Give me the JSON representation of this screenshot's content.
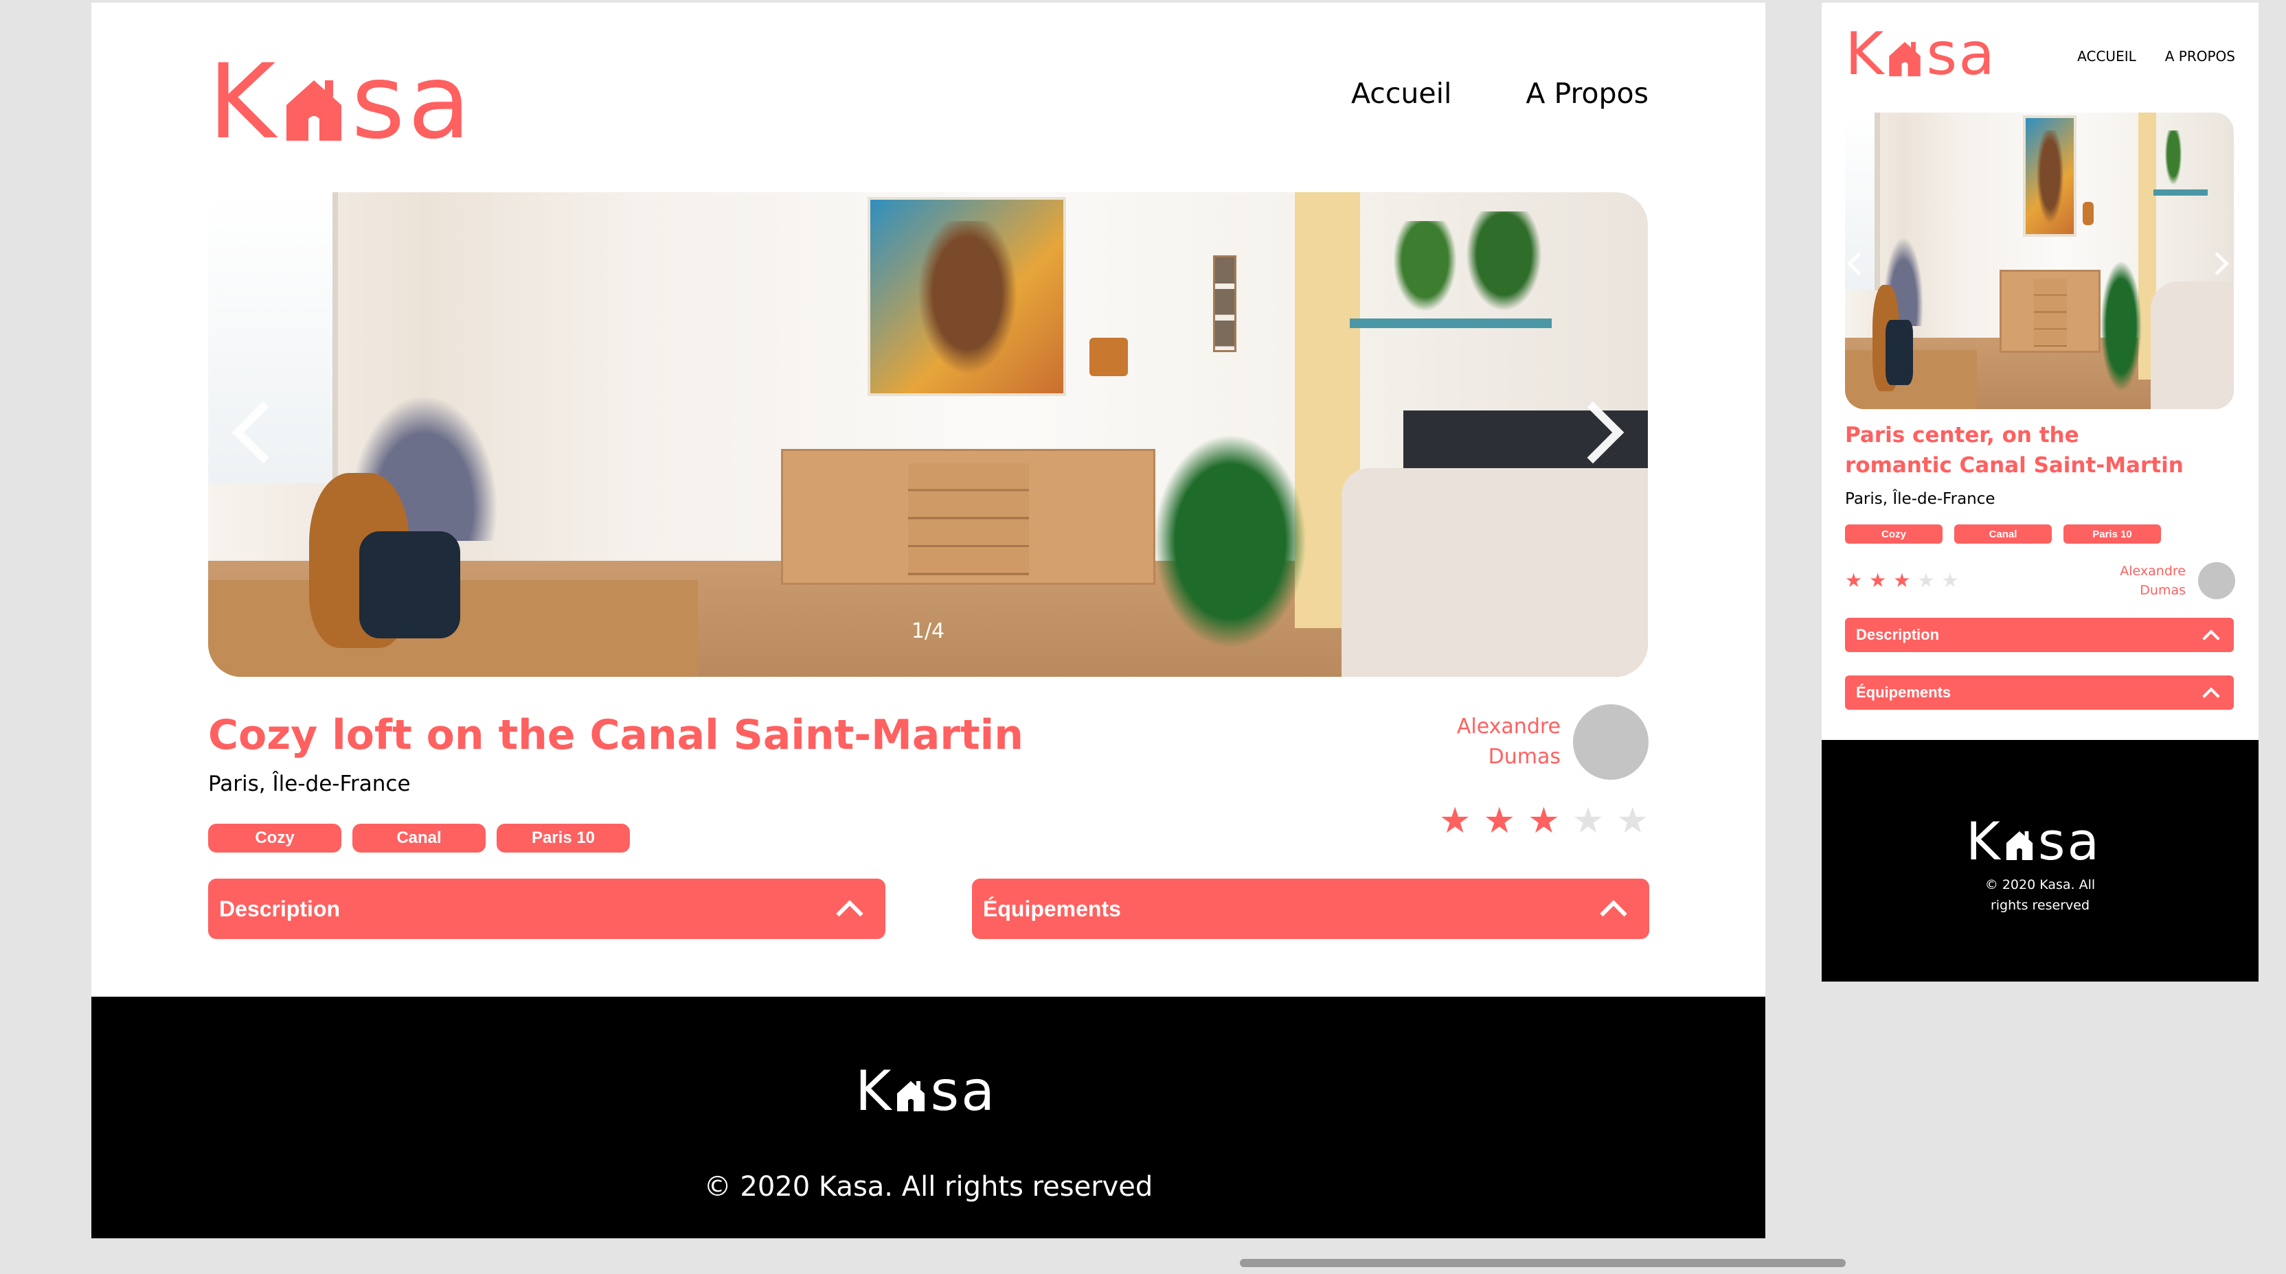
{
  "brand": {
    "logo_left": "K",
    "logo_right": "sa",
    "color": "#ff6060"
  },
  "desktop": {
    "nav": [
      "Accueil",
      "A Propos"
    ],
    "carousel": {
      "counter": "1/4",
      "prev_icon": "chevron-left-icon",
      "next_icon": "chevron-right-icon"
    },
    "title": "Cozy loft on the Canal Saint-Martin",
    "location": "Paris, Île-de-France",
    "tags": [
      "Cozy",
      "Canal",
      "Paris 10"
    ],
    "host": {
      "first": "Alexandre",
      "last": "Dumas"
    },
    "rating": 3,
    "rating_max": 5,
    "collapses": [
      "Description",
      "Équipements"
    ],
    "footer": {
      "copyright": "© 2020 Kasa. All rights reserved"
    }
  },
  "mobile": {
    "nav": [
      "ACCUEIL",
      "A PROPOS"
    ],
    "title": "Paris center, on the romantic Canal Saint-Martin",
    "location": "Paris, Île-de-France",
    "tags": [
      "Cozy",
      "Canal",
      "Paris 10"
    ],
    "host": {
      "first": "Alexandre",
      "last": "Dumas"
    },
    "rating": 3,
    "rating_max": 5,
    "collapses": [
      "Description",
      "Équipements"
    ],
    "footer": {
      "copyright_line1": "© 2020 Kasa. All",
      "copyright_line2": "rights reserved"
    }
  }
}
